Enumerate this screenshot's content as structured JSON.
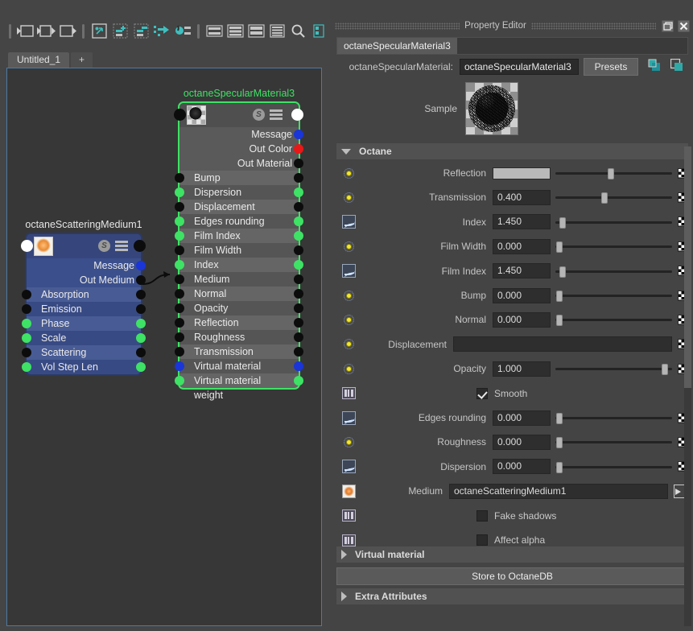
{
  "node_editor": {
    "toolbar_icons": [
      "separator",
      "input-connections-icon",
      "input-output-connections-icon",
      "output-connections-icon",
      "separator",
      "rearrange-graph-icon",
      "add-node-icon",
      "remove-node-icon",
      "pin-node-icon",
      "node-connections-icon",
      "separator",
      "display-mode-simple-icon",
      "display-mode-connected-icon",
      "display-mode-full-icon",
      "display-mode-all-icon",
      "search-icon",
      "graph-settings-icon"
    ],
    "tabs": {
      "active": "Untitled_1",
      "add_label": "+"
    },
    "nodes": [
      {
        "title": "octaneSpecularMaterial3",
        "accent": "#3ee264",
        "selected": true,
        "icon_s": "S",
        "icon_menu": "menu-icon",
        "out_ports": [
          {
            "label": "Message",
            "color": "blue"
          },
          {
            "label": "Out Color",
            "color": "red"
          },
          {
            "label": "Out Material",
            "color": "black"
          }
        ],
        "io_ports": [
          {
            "label": "Bump",
            "left": "black",
            "right": "black"
          },
          {
            "label": "Dispersion",
            "left": "green",
            "right": "green"
          },
          {
            "label": "Displacement",
            "left": "black",
            "right": "black"
          },
          {
            "label": "Edges rounding",
            "left": "green",
            "right": "green"
          },
          {
            "label": "Film Index",
            "left": "green",
            "right": "green"
          },
          {
            "label": "Film Width",
            "left": "black",
            "right": "black"
          },
          {
            "label": "Index",
            "left": "green",
            "right": "green"
          },
          {
            "label": "Medium",
            "left": "black",
            "right": "black"
          },
          {
            "label": "Normal",
            "left": "black",
            "right": "black"
          },
          {
            "label": "Opacity",
            "left": "black",
            "right": "black"
          },
          {
            "label": "Reflection",
            "left": "black",
            "right": "black"
          },
          {
            "label": "Roughness",
            "left": "black",
            "right": "black"
          },
          {
            "label": "Transmission",
            "left": "black",
            "right": "black"
          },
          {
            "label": "Virtual material",
            "left": "blue",
            "right": "blue"
          },
          {
            "label": "Virtual material weight",
            "left": "green",
            "right": "green"
          }
        ]
      },
      {
        "title": "octaneScatteringMedium1",
        "accent": "#3b4f8c",
        "selected": false,
        "icon_s": "S",
        "icon_menu": "menu-icon",
        "out_ports": [
          {
            "label": "Message",
            "color": "blue"
          },
          {
            "label": "Out Medium",
            "color": "black"
          }
        ],
        "io_ports": [
          {
            "label": "Absorption",
            "left": "black",
            "right": "black"
          },
          {
            "label": "Emission",
            "left": "black",
            "right": "black"
          },
          {
            "label": "Phase",
            "left": "green",
            "right": "green"
          },
          {
            "label": "Scale",
            "left": "green",
            "right": "green"
          },
          {
            "label": "Scattering",
            "left": "black",
            "right": "black"
          },
          {
            "label": "Vol Step Len",
            "left": "green",
            "right": "green"
          }
        ]
      }
    ]
  },
  "property_editor": {
    "window_title": "Property Editor",
    "window_buttons": [
      "restore-icon",
      "close-icon"
    ],
    "node_tab": "octaneSpecularMaterial3",
    "name_row": {
      "label": "octaneSpecularMaterial:",
      "value": "octaneSpecularMaterial3",
      "presets_button": "Presets",
      "icons": [
        "copy-tab-icon",
        "new-tab-icon"
      ]
    },
    "sample": {
      "label": "Sample",
      "swatch": "material-preview-swatch"
    },
    "sections": {
      "octane": "Octane",
      "virtual_material": "Virtual material",
      "extra_attributes": "Extra Attributes"
    },
    "store_button": "Store to OctaneDB",
    "highlighted": [
      "Reflection",
      "Transmission"
    ],
    "highlight_color": "#f0714e",
    "rows": [
      {
        "icon": "key-dot-icon",
        "label": "Reflection",
        "type": "color",
        "value": "",
        "swatch_color": "#b9b9b9",
        "slider": 0.48,
        "checker": true
      },
      {
        "icon": "key-dot-icon",
        "label": "Transmission",
        "type": "number",
        "value": "0.400",
        "slider": 0.42,
        "checker": true
      },
      {
        "icon": "curve-icon",
        "label": "Index",
        "type": "number",
        "value": "1.450",
        "slider": 0.04,
        "checker": true
      },
      {
        "icon": "key-dot-icon",
        "label": "Film Width",
        "type": "number",
        "value": "0.000",
        "slider": 0.01,
        "checker": true
      },
      {
        "icon": "curve-icon",
        "label": "Film Index",
        "type": "number",
        "value": "1.450",
        "slider": 0.04,
        "checker": true
      },
      {
        "icon": "key-dot-icon",
        "label": "Bump",
        "type": "number",
        "value": "0.000",
        "slider": 0.01,
        "checker": true
      },
      {
        "icon": "key-dot-icon",
        "label": "Normal",
        "type": "number",
        "value": "0.000",
        "slider": 0.01,
        "checker": true
      },
      {
        "icon": "key-dot-icon",
        "label": "Displacement",
        "type": "wide",
        "value": "",
        "checker": true
      },
      {
        "icon": "key-dot-icon",
        "label": "Opacity",
        "type": "number",
        "value": "1.000",
        "slider": 0.97,
        "checker": true
      },
      {
        "icon": "expand-icon",
        "label": "Smooth",
        "type": "checkbox",
        "checked": true
      },
      {
        "icon": "curve-icon",
        "label": "Edges rounding",
        "type": "number",
        "value": "0.000",
        "slider": 0.01,
        "checker": true
      },
      {
        "icon": "key-dot-icon",
        "label": "Roughness",
        "type": "number",
        "value": "0.000",
        "slider": 0.01,
        "checker": true
      },
      {
        "icon": "curve-icon",
        "label": "Dispersion",
        "type": "number",
        "value": "0.000",
        "slider": 0.01,
        "checker": true
      },
      {
        "icon": "medium-icon",
        "label": "Medium",
        "type": "link",
        "value": "octaneScatteringMedium1"
      },
      {
        "icon": "expand-icon",
        "label": "Fake shadows",
        "type": "checkbox",
        "checked": false
      },
      {
        "icon": "expand-icon",
        "label": "Affect alpha",
        "type": "checkbox",
        "checked": false
      }
    ]
  }
}
